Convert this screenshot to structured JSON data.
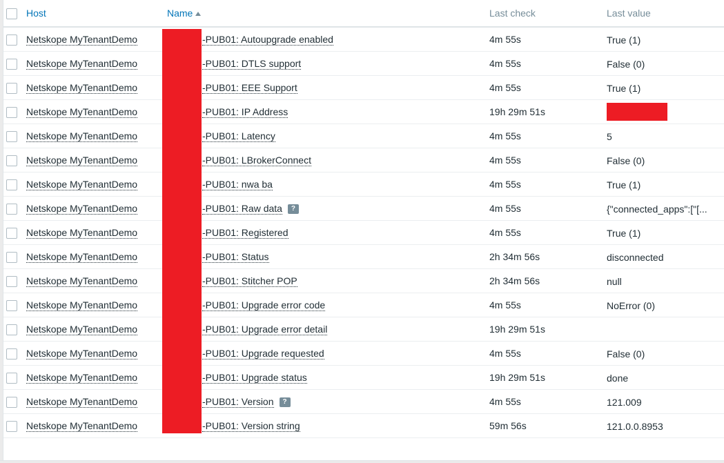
{
  "columns": {
    "host": "Host",
    "name": "Name",
    "last_check": "Last check",
    "last_value": "Last value"
  },
  "sort": {
    "column": "Name",
    "direction": "ascending"
  },
  "colors": {
    "link": "#0275b8",
    "redaction": "#ed1c24",
    "text": "#1f2c33"
  },
  "rows": [
    {
      "host": "Netskope MyTenantDemo",
      "name": "-PUB01: Autoupgrade enabled",
      "last_check": "4m 55s",
      "last_value": "True (1)",
      "hint": false
    },
    {
      "host": "Netskope MyTenantDemo",
      "name": "-PUB01: DTLS support",
      "last_check": "4m 55s",
      "last_value": "False (0)",
      "hint": false
    },
    {
      "host": "Netskope MyTenantDemo",
      "name": "-PUB01: EEE Support",
      "last_check": "4m 55s",
      "last_value": "True (1)",
      "hint": false
    },
    {
      "host": "Netskope MyTenantDemo",
      "name": "-PUB01: IP Address",
      "last_check": "19h 29m 51s",
      "last_value": "",
      "hint": false,
      "value_redacted": true
    },
    {
      "host": "Netskope MyTenantDemo",
      "name": "-PUB01: Latency",
      "last_check": "4m 55s",
      "last_value": "5",
      "hint": false
    },
    {
      "host": "Netskope MyTenantDemo",
      "name": "-PUB01: LBrokerConnect",
      "last_check": "4m 55s",
      "last_value": "False (0)",
      "hint": false
    },
    {
      "host": "Netskope MyTenantDemo",
      "name": "-PUB01: nwa ba",
      "last_check": "4m 55s",
      "last_value": "True (1)",
      "hint": false
    },
    {
      "host": "Netskope MyTenantDemo",
      "name": "-PUB01: Raw data",
      "last_check": "4m 55s",
      "last_value": "{\"connected_apps\":[\"[...",
      "hint": true,
      "hint_label": "?"
    },
    {
      "host": "Netskope MyTenantDemo",
      "name": "-PUB01: Registered",
      "last_check": "4m 55s",
      "last_value": "True (1)",
      "hint": false
    },
    {
      "host": "Netskope MyTenantDemo",
      "name": "-PUB01: Status",
      "last_check": "2h 34m 56s",
      "last_value": "disconnected",
      "hint": false
    },
    {
      "host": "Netskope MyTenantDemo",
      "name": "-PUB01: Stitcher POP",
      "last_check": "2h 34m 56s",
      "last_value": "null",
      "hint": false
    },
    {
      "host": "Netskope MyTenantDemo",
      "name": "-PUB01: Upgrade error code",
      "last_check": "4m 55s",
      "last_value": "NoError (0)",
      "hint": false
    },
    {
      "host": "Netskope MyTenantDemo",
      "name": "-PUB01: Upgrade error detail",
      "last_check": "19h 29m 51s",
      "last_value": "",
      "hint": false
    },
    {
      "host": "Netskope MyTenantDemo",
      "name": "-PUB01: Upgrade requested",
      "last_check": "4m 55s",
      "last_value": "False (0)",
      "hint": false
    },
    {
      "host": "Netskope MyTenantDemo",
      "name": "-PUB01: Upgrade status",
      "last_check": "19h 29m 51s",
      "last_value": "done",
      "hint": false
    },
    {
      "host": "Netskope MyTenantDemo",
      "name": "-PUB01: Version",
      "last_check": "4m 55s",
      "last_value": "121.009",
      "hint": true,
      "hint_label": "?"
    },
    {
      "host": "Netskope MyTenantDemo",
      "name": "-PUB01: Version string",
      "last_check": "59m 56s",
      "last_value": "121.0.0.8953",
      "hint": false
    }
  ]
}
